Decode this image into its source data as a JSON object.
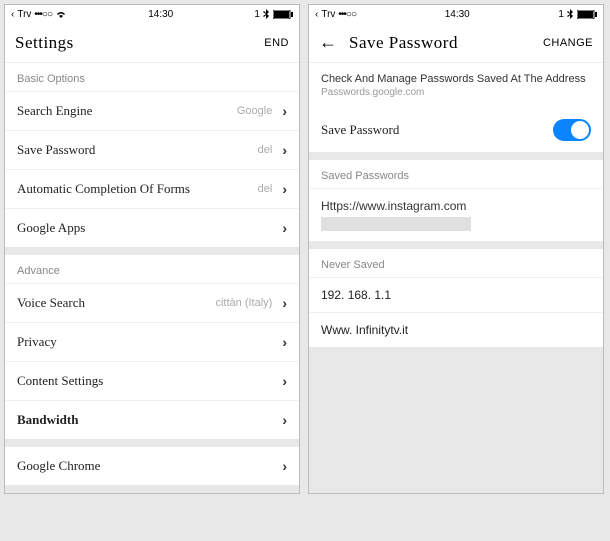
{
  "left": {
    "status": {
      "carrier": "Trv",
      "time": "14:30",
      "bt_pct": "1"
    },
    "header": {
      "title": "Settings",
      "action": "END"
    },
    "basic_header": "Basic Options",
    "rows": {
      "search_engine": {
        "label": "Search Engine",
        "value": "Google"
      },
      "save_password": {
        "label": "Save Password",
        "value": "del"
      },
      "autofill": {
        "label": "Automatic Completion Of Forms",
        "value": "del"
      },
      "google_apps": {
        "label": "Google Apps"
      }
    },
    "advanced_header": "Advance",
    "advanced": {
      "voice_search": {
        "label": "Voice Search",
        "value": "cittàn (Italy)"
      },
      "privacy": {
        "label": "Privacy"
      },
      "content": {
        "label": "Content Settings"
      },
      "bandwidth": {
        "label": "Bandwidth"
      }
    },
    "chrome": {
      "label": "Google Chrome"
    }
  },
  "right": {
    "status": {
      "carrier": "Trv",
      "time": "14:30",
      "bt_pct": "1"
    },
    "header": {
      "title": "Save Password",
      "action": "CHANGE"
    },
    "description": "Check And Manage Passwords Saved At The Address",
    "description_link": "Passwords.google.com",
    "toggle_row": {
      "label": "Save Password"
    },
    "saved_header": "Saved Passwords",
    "saved_url": "Https://www.instagram.com",
    "never_header": "Never Saved",
    "never_items": [
      "192. 168. 1.1",
      "Www. Infinitytv.it"
    ]
  }
}
